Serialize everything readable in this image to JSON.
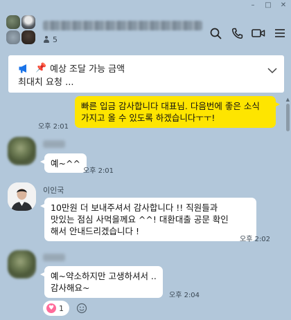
{
  "window": {
    "minimize": "–",
    "maximize": "□",
    "close": "✕"
  },
  "header": {
    "title": "██ ███ ███ █████ ████",
    "member_count": "5"
  },
  "notice": {
    "pin": "📌",
    "title": "예상 조달 가능 금액",
    "body": "최대치 요청 ..."
  },
  "messages": [
    {
      "direction": "out",
      "text_line1": "빠른 입금 감사합니다 대표님. 다음번에 좋은 소식",
      "text_line2": "가지고 올 수 있도록 하겠습니다ㅜㅜ!",
      "time": "오후 2:01"
    },
    {
      "direction": "in",
      "sender": "████",
      "text": "예~^^",
      "time": "오후 2:01"
    },
    {
      "direction": "in",
      "sender": "이인국",
      "text_line1": "10만원 더 보내주셔서 감사합니다 !! 직원들과",
      "text_line2": "맛있는 점심 사먹을께요 ^^! 대환대출 공문 확인",
      "text_line3": "해서 안내드리겠습니다 !",
      "time": "오후 2:02"
    },
    {
      "direction": "in",
      "sender": "████",
      "text_line1": "예~약소하지만 고생하셔서 ..",
      "text_line2": "감사해요~",
      "time": "오후 2:04",
      "reaction_count": "1"
    }
  ],
  "colors": {
    "background": "#b2c7da",
    "outgoing_bubble": "#fee500",
    "incoming_bubble": "#ffffff",
    "accent": "#1a73e8"
  }
}
